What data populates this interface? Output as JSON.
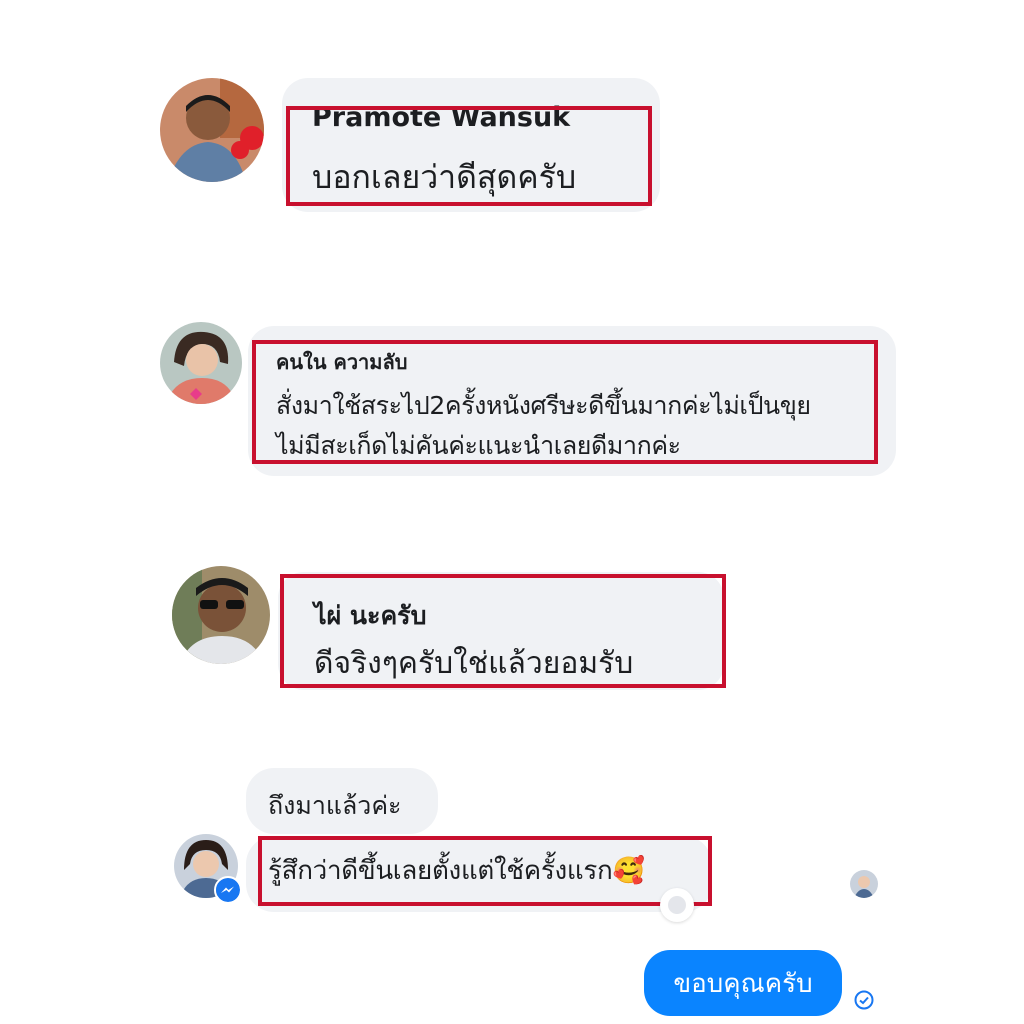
{
  "comments": [
    {
      "name": "Pramote Wansuk",
      "text": "บอกเลยว่าดีสุดครับ"
    },
    {
      "name": "คนใน ความลับ",
      "text_lines": [
        "สั่งมาใช้สระไป2ครั้งหนังศรีษะดีขึ้นมากค่ะไม่เป็นขุย",
        "ไม่มีสะเก็ดไม่คันค่ะแนะนำเลยดีมากค่ะ"
      ]
    },
    {
      "name": "ไผ่ นะครับ",
      "text": "ดีจริงๆครับใช่แล้วยอมรับ"
    }
  ],
  "chat": {
    "received": [
      "ถึงมาแล้วค่ะ",
      "รู้สึกว่าดีขึ้นเลยตั้งแต่ใช้ครั้งแรก🥰"
    ],
    "sent": "ขอบคุณครับ"
  },
  "colors": {
    "highlight": "#c8102e",
    "bubble": "#f0f2f5",
    "sent_bubble": "#0a84ff",
    "messenger": "#1877f2"
  }
}
